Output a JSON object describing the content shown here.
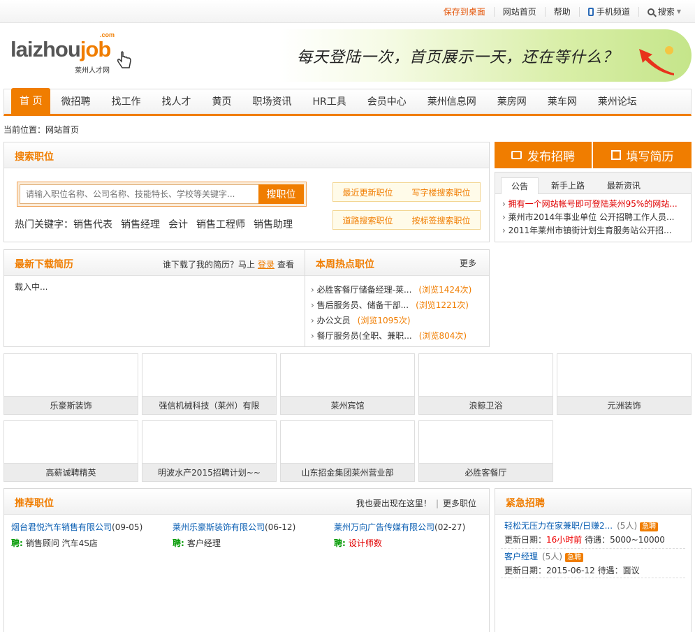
{
  "topbar": {
    "save_desktop": "保存到桌面",
    "home": "网站首页",
    "help": "帮助",
    "mobile": "手机频道",
    "search": "搜索"
  },
  "logo": {
    "com": ".com",
    "main_a": "laizhou",
    "main_b": "job",
    "sub": "莱州人才网"
  },
  "banner": {
    "text": "每天登陆一次，首页展示一天，还在等什么？"
  },
  "nav": [
    "首 页",
    "微招聘",
    "找工作",
    "找人才",
    "黄页",
    "职场资讯",
    "HR工具",
    "会员中心",
    "莱州信息网",
    "莱房网",
    "莱车网",
    "莱州论坛"
  ],
  "breadcrumb": "当前位置：网站首页",
  "search": {
    "title": "搜索职位",
    "placeholder": "请输入职位名称、公司名称、技能特长、学校等关键字...",
    "button": "搜职位",
    "hot_label": "热门关键字：",
    "hot_keywords": [
      "销售代表",
      "销售经理",
      "会计",
      "销售工程师",
      "销售助理"
    ],
    "quick": [
      [
        "最近更新职位",
        "写字楼搜索职位"
      ],
      [
        "道路搜索职位",
        "按标签搜索职位"
      ]
    ]
  },
  "actions": {
    "post": "发布招聘",
    "resume": "填写简历"
  },
  "notice": {
    "tabs": [
      "公告",
      "新手上路",
      "最新资讯"
    ],
    "items": [
      "拥有一个网站帐号即可登陆莱州95%的网站...",
      "莱州市2014年事业单位 公开招聘工作人员...",
      "2011年莱州市镇街计划生育服务站公开招..."
    ],
    "highlight_color": "#e00000"
  },
  "resume_dl": {
    "title": "最新下载简历",
    "extra_a": "谁下载了我的简历？马上",
    "login": "登录",
    "extra_b": "查看",
    "loading": "载入中..."
  },
  "hot_jobs": {
    "title": "本周热点职位",
    "more": "更多",
    "items": [
      {
        "name": "必胜客餐厅储备经理-莱...",
        "views": "(浏览1424次)"
      },
      {
        "name": "售后服务员、储备干部...",
        "views": "(浏览1221次)"
      },
      {
        "name": "办公文员",
        "views": "(浏览1095次)"
      },
      {
        "name": "餐厅服务员(全职、兼职...",
        "views": "(浏览804次)"
      }
    ]
  },
  "companies": [
    [
      "乐豪斯装饰",
      "强信机械科技（莱州）有限",
      "莱州宾馆",
      "浪鲸卫浴",
      "元洲装饰"
    ],
    [
      "高薪诚聘精英",
      "明波水产2015招聘计划~~",
      "山东招金集团莱州营业部",
      "必胜客餐厅"
    ]
  ],
  "recommended": {
    "title": "推荐职位",
    "extra_a": "我也要出现在这里！",
    "extra_sep": "|",
    "extra_b": "更多职位",
    "items": [
      {
        "company": "烟台君悦汽车销售有限公司",
        "date": "(09-05)",
        "pin": "聘:",
        "jobs": "销售顾问 汽车4S店",
        "jobs_color": "#333333"
      },
      {
        "company": "莱州乐豪斯装饰有限公司",
        "date": "(06-12)",
        "pin": "聘:",
        "jobs": "客户经理",
        "jobs_color": "#333333"
      },
      {
        "company": "莱州万向广告传媒有限公司",
        "date": "(02-27)",
        "pin": "聘:",
        "jobs": "设计师数",
        "jobs_color": "#e00000"
      }
    ]
  },
  "urgent": {
    "title": "紧急招聘",
    "items": [
      {
        "title": "轻松无压力在家兼职/日赚2...",
        "count": "(5人)",
        "badge": "急聘",
        "date_label": "更新日期：",
        "date": "16小时前",
        "pay": "待遇：5000~10000"
      },
      {
        "title": "客户经理",
        "count": "(5人)",
        "badge": "急聘",
        "date_label": "更新日期：",
        "date": "2015-06-12",
        "pay": "待遇：面议"
      }
    ]
  }
}
